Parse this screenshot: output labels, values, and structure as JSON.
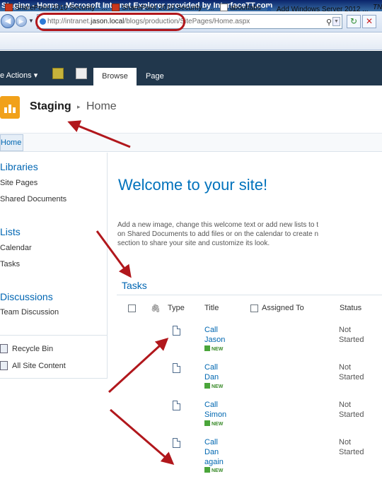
{
  "window": {
    "title": "Staging - Home - Microsoft Internet Explorer provided by InterfaceTT.com"
  },
  "address_bar": {
    "url_prefix": "http://intranet.",
    "url_host": "jason.local",
    "url_rest": "/blogs/production/SitePages/Home.aspx",
    "search_glyph": "⚲",
    "dropdown_glyph": "▼"
  },
  "favorites": [
    {
      "label": "SharePoint 2010  Security - ...",
      "icon": "sharepoint-icon"
    },
    {
      "label": "SharePoint 2010  Security - ...",
      "icon": "sharepoint-icon"
    },
    {
      "label": "abouttabs",
      "icon": "page-icon"
    },
    {
      "label": "Add Windows Server 2012 ...",
      "icon": "star-icon"
    },
    {
      "label": "TN",
      "icon": "page-icon"
    }
  ],
  "ribbon": {
    "site_actions": "e Actions ▾",
    "tab_browse": "Browse",
    "tab_page": "Page"
  },
  "breadcrumb": {
    "site": "Staging",
    "separator": "▸",
    "page": "Home"
  },
  "top_nav": {
    "home": "Home"
  },
  "left_nav": {
    "groups": [
      {
        "heading": "Libraries",
        "items": [
          "Site Pages",
          "Shared Documents"
        ]
      },
      {
        "heading": "Lists",
        "items": [
          "Calendar",
          "Tasks"
        ]
      },
      {
        "heading": "Discussions",
        "items": [
          "Team Discussion"
        ]
      }
    ],
    "recycle_bin": "Recycle Bin",
    "all_site_content": "All Site Content"
  },
  "main": {
    "welcome": "Welcome to your site!",
    "intro_lines": [
      "Add a new image, change this welcome text or add new lists to t",
      "on Shared Documents to add files or on the calendar to create n",
      "section to share your site and customize its look."
    ],
    "tasks_title": "Tasks",
    "columns": {
      "type": "Type",
      "title": "Title",
      "assigned_to": "Assigned To",
      "status": "Status",
      "attachment_glyph": "🖇"
    },
    "new_label": "NEW",
    "rows": [
      {
        "title": "Call\nJason",
        "status": "Not\nStarted"
      },
      {
        "title": "Call\nDan",
        "status": "Not\nStarted"
      },
      {
        "title": "Call\nSimon",
        "status": "Not\nStarted"
      },
      {
        "title": "Call\nDan\nagain",
        "status": "Not\nStarted"
      }
    ]
  },
  "colors": {
    "ribbon": "#21374c",
    "link_blue": "#0072bc",
    "annotation_red": "#b1171c",
    "logo_orange": "#f1a11a"
  }
}
